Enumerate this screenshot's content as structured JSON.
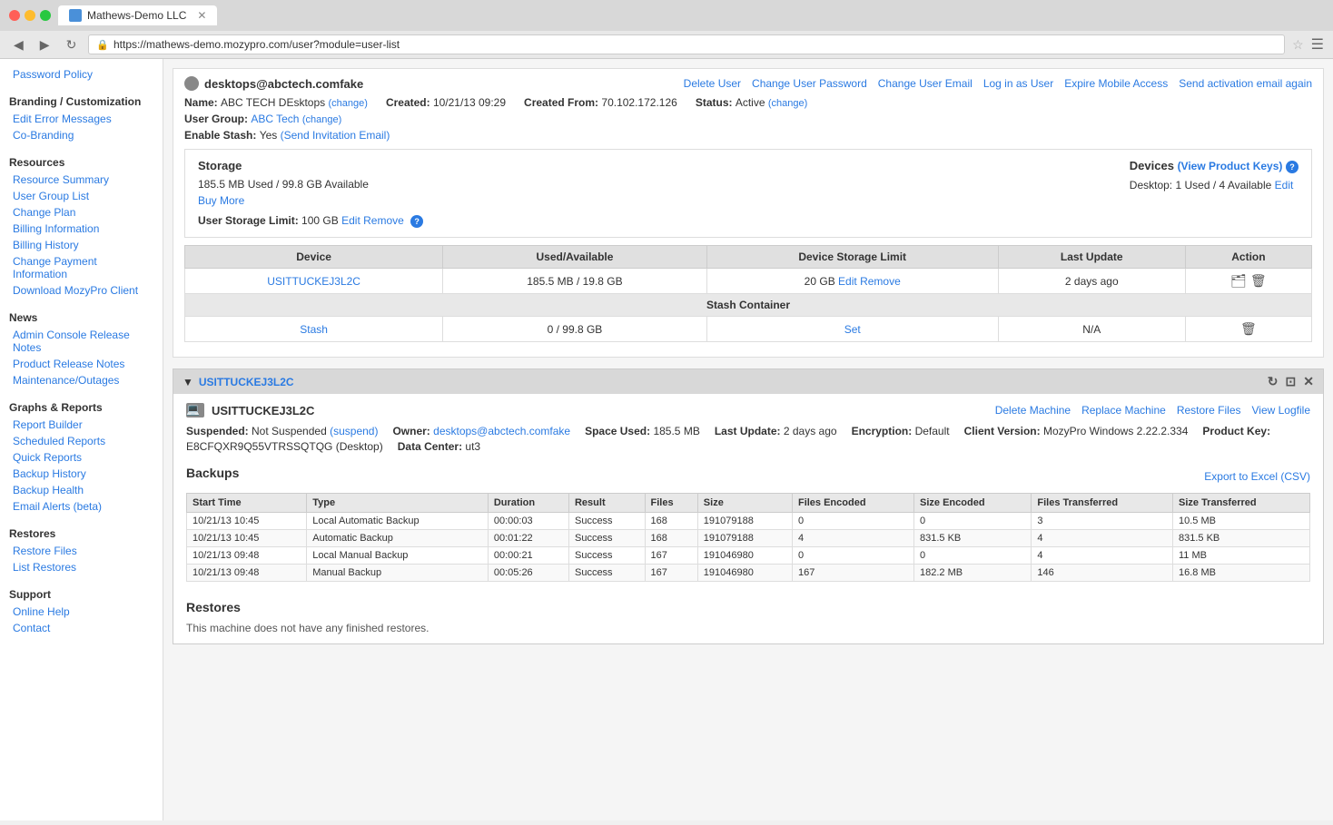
{
  "browser": {
    "tab_title": "Mathews-Demo LLC",
    "url": "https://mathews-demo.mozypro.com/user?module=user-list",
    "back_btn": "◀",
    "forward_btn": "▶",
    "refresh_btn": "↻"
  },
  "sidebar": {
    "sections": [
      {
        "title": "Branding / Customization",
        "items": [
          "Edit Error Messages",
          "Co-Branding"
        ]
      },
      {
        "title": "Resources",
        "items": [
          "Resource Summary",
          "User Group List",
          "Change Plan",
          "Billing Information",
          "Billing History",
          "Change Payment Information",
          "Download MozyPro Client"
        ]
      },
      {
        "title": "News",
        "items": [
          "Admin Console Release Notes",
          "Product Release Notes",
          "Maintenance/Outages"
        ]
      },
      {
        "title": "Graphs & Reports",
        "items": [
          "Report Builder",
          "Scheduled Reports",
          "Quick Reports",
          "Backup History",
          "Backup Health",
          "Email Alerts (beta)"
        ]
      },
      {
        "title": "Restores",
        "items": [
          "Restore Files",
          "List Restores"
        ]
      },
      {
        "title": "Support",
        "items": [
          "Online Help",
          "Contact"
        ]
      }
    ],
    "password_policy": "Password Policy"
  },
  "user": {
    "email": "desktops@abctech.comfake",
    "icon_label": "user-avatar",
    "actions": [
      {
        "label": "Delete User",
        "name": "delete-user-link"
      },
      {
        "label": "Change User Password",
        "name": "change-password-link"
      },
      {
        "label": "Change User Email",
        "name": "change-email-link"
      },
      {
        "label": "Log in as User",
        "name": "login-as-user-link"
      },
      {
        "label": "Expire Mobile Access",
        "name": "expire-mobile-link"
      },
      {
        "label": "Send activation email again",
        "name": "send-activation-link"
      }
    ],
    "name_label": "Name:",
    "name_value": "ABC TECH DEsktops",
    "name_change": "(change)",
    "created_label": "Created:",
    "created_value": "10/21/13 09:29",
    "created_from_label": "Created From:",
    "created_from_value": "70.102.172.126",
    "status_label": "Status:",
    "status_value": "Active",
    "status_change": "(change)",
    "group_label": "User Group:",
    "group_value": "ABC Tech",
    "group_change": "(change)",
    "stash_label": "Enable Stash:",
    "stash_value": "Yes",
    "stash_link": "(Send Invitation Email)"
  },
  "storage": {
    "storage_title": "Storage",
    "storage_used": "185.5 MB Used / 99.8 GB Available",
    "buy_more": "Buy More",
    "user_storage_limit_label": "User Storage Limit:",
    "user_storage_limit_value": "100 GB",
    "edit_limit": "Edit",
    "remove_limit": "Remove",
    "devices_title": "Devices",
    "view_product_keys": "(View Product Keys)",
    "devices_value": "Desktop: 1 Used / 4 Available",
    "edit_devices": "Edit"
  },
  "device_table": {
    "headers": [
      "Device",
      "Used/Available",
      "Device Storage Limit",
      "Last Update",
      "Action"
    ],
    "rows": [
      {
        "device": "USITTUCKEJ3L2C",
        "used_available": "185.5 MB / 19.8 GB",
        "storage_limit": "20 GB",
        "edit": "Edit",
        "remove": "Remove",
        "last_update": "2 days ago",
        "action": "folder-trash"
      }
    ],
    "stash_header": "Stash Container",
    "stash_rows": [
      {
        "device": "Stash",
        "used_available": "0 / 99.8 GB",
        "storage_limit": "Set",
        "last_update": "N/A",
        "action": "trash"
      }
    ]
  },
  "device_panel": {
    "panel_title": "USITTUCKEJ3L2C",
    "device_icon": "computer",
    "device_name": "USITTUCKEJ3L2C",
    "actions": [
      "Delete Machine",
      "Replace Machine",
      "Restore Files",
      "View Logfile"
    ],
    "suspended_label": "Suspended:",
    "suspended_value": "Not Suspended",
    "suspend_link": "(suspend)",
    "owner_label": "Owner:",
    "owner_value": "desktops@abctech.comfake",
    "space_used_label": "Space Used:",
    "space_used_value": "185.5 MB",
    "last_update_label": "Last Update:",
    "last_update_value": "2 days ago",
    "encryption_label": "Encryption:",
    "encryption_value": "Default",
    "client_version_label": "Client Version:",
    "client_version_value": "MozyPro Windows 2.22.2.334",
    "product_key_label": "Product Key:",
    "product_key_value": "",
    "id_value": "E8CFQXR9Q55VTRSSQTQG (Desktop)",
    "data_center_label": "Data Center:",
    "data_center_value": "ut3"
  },
  "backups": {
    "title": "Backups",
    "export_label": "Export to Excel (CSV)",
    "headers": [
      "Start Time",
      "Type",
      "Duration",
      "Result",
      "Files",
      "Size",
      "Files Encoded",
      "Size Encoded",
      "Files Transferred",
      "Size Transferred"
    ],
    "rows": [
      {
        "start_time": "10/21/13 10:45",
        "type": "Local Automatic Backup",
        "duration": "00:00:03",
        "result": "Success",
        "files": "168",
        "size": "191079188",
        "files_encoded": "0",
        "size_encoded": "0",
        "files_transferred": "3",
        "size_transferred": "10.5 MB"
      },
      {
        "start_time": "10/21/13 10:45",
        "type": "Automatic Backup",
        "duration": "00:01:22",
        "result": "Success",
        "files": "168",
        "size": "191079188",
        "files_encoded": "4",
        "size_encoded": "831.5 KB",
        "files_transferred": "4",
        "size_transferred": "831.5 KB"
      },
      {
        "start_time": "10/21/13 09:48",
        "type": "Local Manual Backup",
        "duration": "00:00:21",
        "result": "Success",
        "files": "167",
        "size": "191046980",
        "files_encoded": "0",
        "size_encoded": "0",
        "files_transferred": "4",
        "size_transferred": "11 MB"
      },
      {
        "start_time": "10/21/13 09:48",
        "type": "Manual Backup",
        "duration": "00:05:26",
        "result": "Success",
        "files": "167",
        "size": "191046980",
        "files_encoded": "167",
        "size_encoded": "182.2 MB",
        "files_transferred": "146",
        "size_transferred": "16.8 MB"
      }
    ]
  },
  "restores": {
    "title": "Restores",
    "no_restores_msg": "This machine does not have any finished restores."
  }
}
